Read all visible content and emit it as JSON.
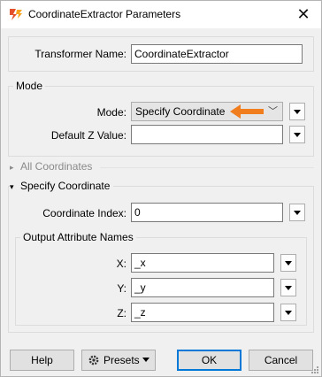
{
  "window": {
    "title": "CoordinateExtractor Parameters",
    "close_glyph": "✕"
  },
  "transformer": {
    "label": "Transformer Name:",
    "value": "CoordinateExtractor"
  },
  "mode_group": {
    "legend": "Mode",
    "mode_label": "Mode:",
    "mode_value": "Specify Coordinate",
    "default_z_label": "Default Z Value:",
    "default_z_value": ""
  },
  "all_coordinates": {
    "label": "All Coordinates",
    "expanded": false
  },
  "specify_coordinate": {
    "label": "Specify Coordinate",
    "expanded": true,
    "index_label": "Coordinate Index:",
    "index_value": "0",
    "output_legend": "Output Attribute Names",
    "x_label": "X:",
    "x_value": "_x",
    "y_label": "Y:",
    "y_value": "_y",
    "z_label": "Z:",
    "z_value": "_z"
  },
  "buttons": {
    "help": "Help",
    "presets": "Presets",
    "ok": "OK",
    "cancel": "Cancel"
  },
  "icons": {
    "title": "fme-transformer-icon",
    "arrow_annotation": "orange-arrow-left-icon",
    "presets": "gear-icon"
  },
  "colors": {
    "annotation_arrow": "#f07d1e",
    "focus_border": "#0078d7"
  }
}
